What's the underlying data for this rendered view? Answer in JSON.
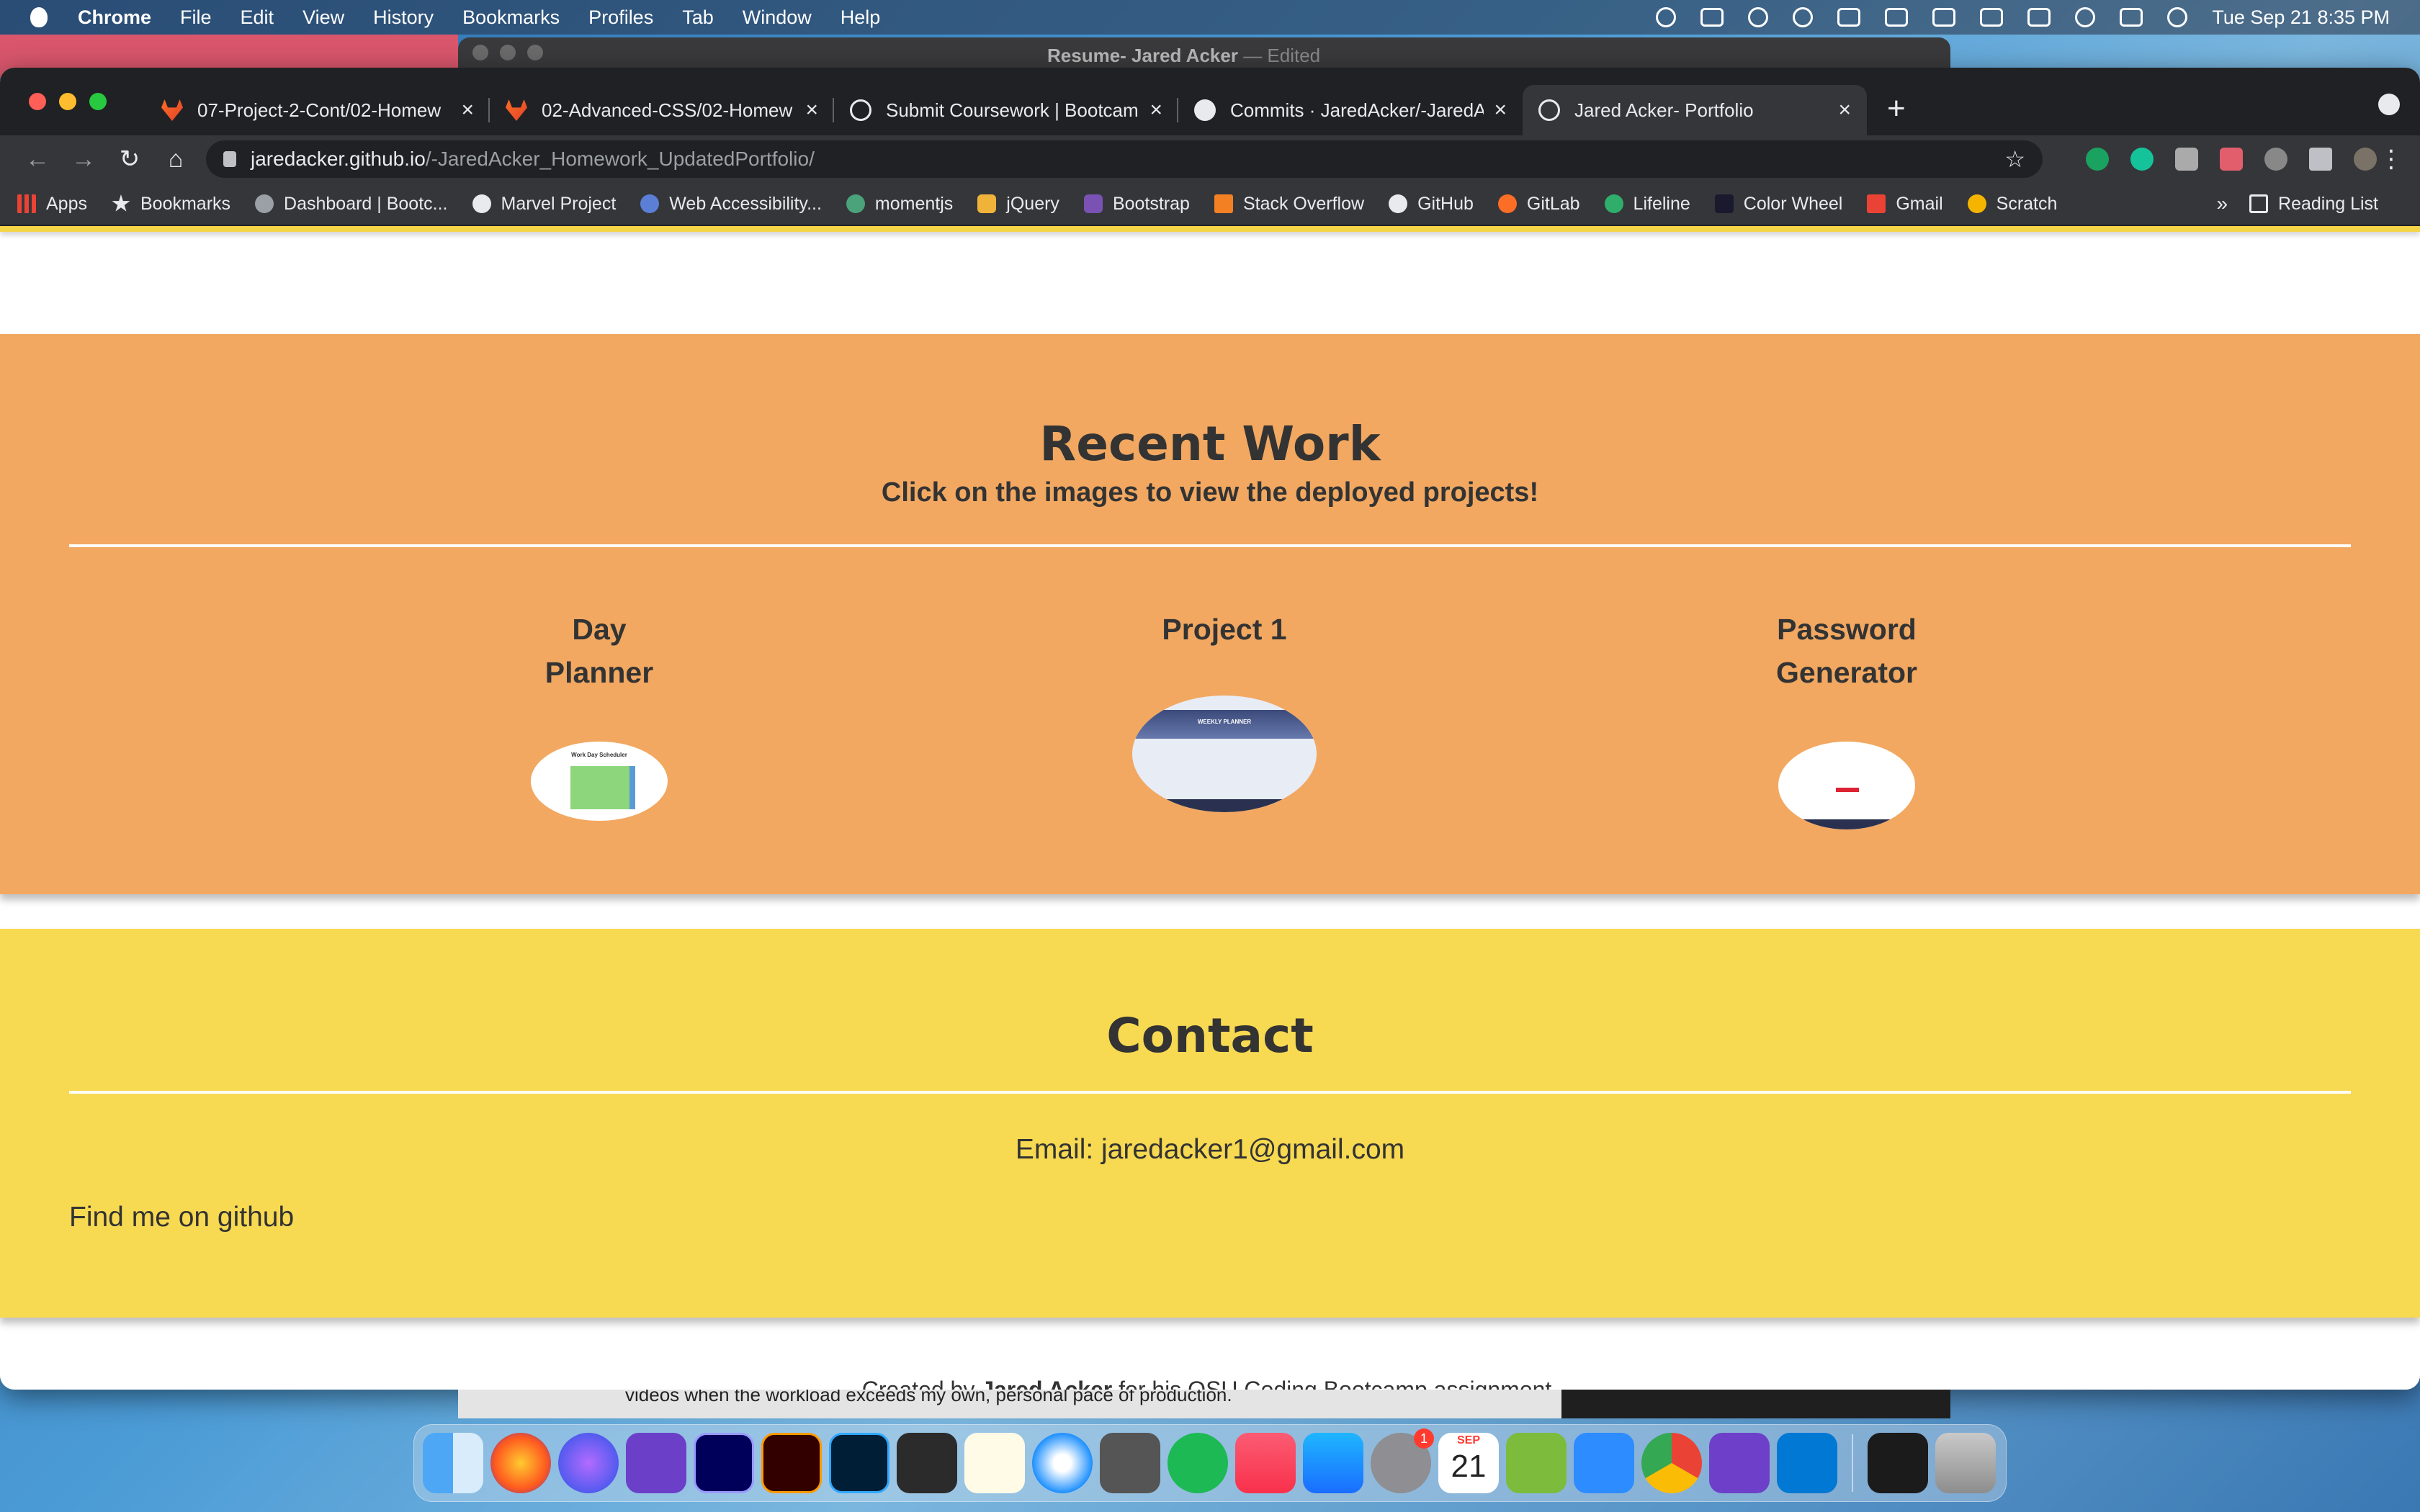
{
  "menubar": {
    "app_name": "Chrome",
    "menus": [
      "File",
      "Edit",
      "View",
      "History",
      "Bookmarks",
      "Profiles",
      "Tab",
      "Window",
      "Help"
    ],
    "datetime": "Tue Sep 21  8:35 PM"
  },
  "background_window": {
    "title": "Resume- Jared Acker",
    "edited": "— Edited",
    "text_snippet": "videos when the workload exceeds my own, personal pace of production."
  },
  "tabs": [
    {
      "label": "07-Project-2-Cont/02-Homew",
      "icon": "gitlab-icon",
      "active": false
    },
    {
      "label": "02-Advanced-CSS/02-Homew",
      "icon": "gitlab-icon",
      "active": false
    },
    {
      "label": "Submit Coursework | Bootcamp",
      "icon": "globe-icon",
      "active": false
    },
    {
      "label": "Commits · JaredAcker/-JaredA",
      "icon": "github-icon",
      "active": false
    },
    {
      "label": "Jared Acker- Portfolio",
      "icon": "globe-icon",
      "active": true
    }
  ],
  "omnibox": {
    "host": "jaredacker.github.io",
    "path": "/-JaredAcker_Homework_UpdatedPortfolio/"
  },
  "bookmarks": {
    "items": [
      "Apps",
      "Bookmarks",
      "Dashboard | Bootc...",
      "Marvel Project",
      "Web Accessibility...",
      "momentjs",
      "jQuery",
      "Bootstrap",
      "Stack Overflow",
      "GitHub",
      "GitLab",
      "Lifeline",
      "Color Wheel",
      "Gmail",
      "Scratch"
    ],
    "more": "»",
    "reading_list": "Reading List"
  },
  "recent_work": {
    "title": "Recent Work",
    "subtitle": "Click on the images to view the deployed projects!",
    "projects": [
      {
        "name_line1": "Day",
        "name_line2": "Planner"
      },
      {
        "name_line1": "Project 1",
        "name_line2": ""
      },
      {
        "name_line1": "Password",
        "name_line2": "Generator"
      }
    ],
    "thumb_text": {
      "day_planner": "Work Day Scheduler",
      "project1": "WEEKLY PLANNER"
    }
  },
  "contact": {
    "title": "Contact",
    "email": "Email: jaredacker1@gmail.com",
    "github": "Find me on github"
  },
  "footer": {
    "prefix": "Created by ",
    "name": "Jared Acker",
    "suffix": " for his OSU Coding Bootcamp assignment."
  },
  "dock": {
    "calendar_month": "SEP",
    "calendar_day": "21",
    "settings_badge": "1"
  },
  "colors": {
    "recent_bg": "#f2a861",
    "contact_bg": "#f7d952",
    "tab_bar": "#202124",
    "active_tab": "#35363a"
  }
}
